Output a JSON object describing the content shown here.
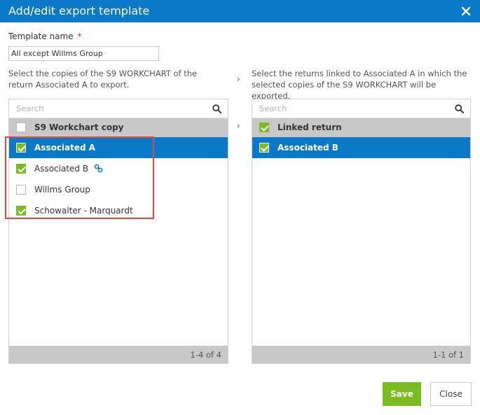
{
  "dialog": {
    "title": "Add/edit export template"
  },
  "template_name": {
    "label": "Template name",
    "required_mark": "*",
    "value": "All except Willms Group"
  },
  "left_panel": {
    "instruction": "Select the copies of the S9 WORKCHART of the return Associated A to export.",
    "search_placeholder": "Search",
    "header": {
      "label": "S9 Workchart copy",
      "checked": false
    },
    "items": [
      {
        "label": "Associated A",
        "checked": true,
        "selected": true,
        "linked": false
      },
      {
        "label": "Associated B",
        "checked": true,
        "selected": false,
        "linked": true
      },
      {
        "label": "Willms Group",
        "checked": false,
        "selected": false,
        "linked": false
      },
      {
        "label": "Schowalter - Marquardt",
        "checked": true,
        "selected": false,
        "linked": false
      }
    ],
    "count": "1-4 of 4"
  },
  "right_panel": {
    "instruction": "Select the returns linked to Associated A in which the selected copies of the S9 WORKCHART will be exported.",
    "search_placeholder": "Search",
    "header": {
      "label": "Linked return",
      "checked": true
    },
    "items": [
      {
        "label": "Associated B",
        "checked": true,
        "selected": true
      }
    ],
    "count": "1-1 of 1"
  },
  "separators": {
    "arrow": "›"
  },
  "buttons": {
    "save": "Save",
    "close": "Close"
  },
  "colors": {
    "title_bar": "#0a79c7",
    "selected_row": "#0a79c7",
    "checkbox_checked": "#7bbd20",
    "save_button": "#7bbd20",
    "highlight_box": "#e0483e"
  },
  "icons": {
    "close": "close-icon",
    "search": "search-icon",
    "link": "link-icon",
    "checkbox": "checkbox-icon"
  }
}
